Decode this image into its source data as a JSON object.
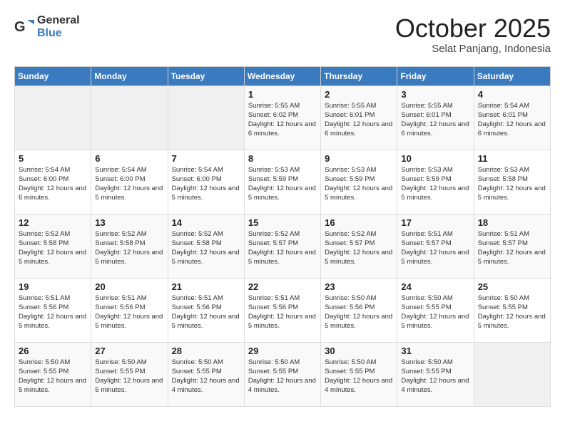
{
  "logo": {
    "general": "General",
    "blue": "Blue"
  },
  "title": "October 2025",
  "location": "Selat Panjang, Indonesia",
  "headers": [
    "Sunday",
    "Monday",
    "Tuesday",
    "Wednesday",
    "Thursday",
    "Friday",
    "Saturday"
  ],
  "weeks": [
    [
      {
        "day": "",
        "info": ""
      },
      {
        "day": "",
        "info": ""
      },
      {
        "day": "",
        "info": ""
      },
      {
        "day": "1",
        "info": "Sunrise: 5:55 AM\nSunset: 6:02 PM\nDaylight: 12 hours and 6 minutes."
      },
      {
        "day": "2",
        "info": "Sunrise: 5:55 AM\nSunset: 6:01 PM\nDaylight: 12 hours and 6 minutes."
      },
      {
        "day": "3",
        "info": "Sunrise: 5:55 AM\nSunset: 6:01 PM\nDaylight: 12 hours and 6 minutes."
      },
      {
        "day": "4",
        "info": "Sunrise: 5:54 AM\nSunset: 6:01 PM\nDaylight: 12 hours and 6 minutes."
      }
    ],
    [
      {
        "day": "5",
        "info": "Sunrise: 5:54 AM\nSunset: 6:00 PM\nDaylight: 12 hours and 6 minutes."
      },
      {
        "day": "6",
        "info": "Sunrise: 5:54 AM\nSunset: 6:00 PM\nDaylight: 12 hours and 5 minutes."
      },
      {
        "day": "7",
        "info": "Sunrise: 5:54 AM\nSunset: 6:00 PM\nDaylight: 12 hours and 5 minutes."
      },
      {
        "day": "8",
        "info": "Sunrise: 5:53 AM\nSunset: 5:59 PM\nDaylight: 12 hours and 5 minutes."
      },
      {
        "day": "9",
        "info": "Sunrise: 5:53 AM\nSunset: 5:59 PM\nDaylight: 12 hours and 5 minutes."
      },
      {
        "day": "10",
        "info": "Sunrise: 5:53 AM\nSunset: 5:59 PM\nDaylight: 12 hours and 5 minutes."
      },
      {
        "day": "11",
        "info": "Sunrise: 5:53 AM\nSunset: 5:58 PM\nDaylight: 12 hours and 5 minutes."
      }
    ],
    [
      {
        "day": "12",
        "info": "Sunrise: 5:52 AM\nSunset: 5:58 PM\nDaylight: 12 hours and 5 minutes."
      },
      {
        "day": "13",
        "info": "Sunrise: 5:52 AM\nSunset: 5:58 PM\nDaylight: 12 hours and 5 minutes."
      },
      {
        "day": "14",
        "info": "Sunrise: 5:52 AM\nSunset: 5:58 PM\nDaylight: 12 hours and 5 minutes."
      },
      {
        "day": "15",
        "info": "Sunrise: 5:52 AM\nSunset: 5:57 PM\nDaylight: 12 hours and 5 minutes."
      },
      {
        "day": "16",
        "info": "Sunrise: 5:52 AM\nSunset: 5:57 PM\nDaylight: 12 hours and 5 minutes."
      },
      {
        "day": "17",
        "info": "Sunrise: 5:51 AM\nSunset: 5:57 PM\nDaylight: 12 hours and 5 minutes."
      },
      {
        "day": "18",
        "info": "Sunrise: 5:51 AM\nSunset: 5:57 PM\nDaylight: 12 hours and 5 minutes."
      }
    ],
    [
      {
        "day": "19",
        "info": "Sunrise: 5:51 AM\nSunset: 5:56 PM\nDaylight: 12 hours and 5 minutes."
      },
      {
        "day": "20",
        "info": "Sunrise: 5:51 AM\nSunset: 5:56 PM\nDaylight: 12 hours and 5 minutes."
      },
      {
        "day": "21",
        "info": "Sunrise: 5:51 AM\nSunset: 5:56 PM\nDaylight: 12 hours and 5 minutes."
      },
      {
        "day": "22",
        "info": "Sunrise: 5:51 AM\nSunset: 5:56 PM\nDaylight: 12 hours and 5 minutes."
      },
      {
        "day": "23",
        "info": "Sunrise: 5:50 AM\nSunset: 5:56 PM\nDaylight: 12 hours and 5 minutes."
      },
      {
        "day": "24",
        "info": "Sunrise: 5:50 AM\nSunset: 5:55 PM\nDaylight: 12 hours and 5 minutes."
      },
      {
        "day": "25",
        "info": "Sunrise: 5:50 AM\nSunset: 5:55 PM\nDaylight: 12 hours and 5 minutes."
      }
    ],
    [
      {
        "day": "26",
        "info": "Sunrise: 5:50 AM\nSunset: 5:55 PM\nDaylight: 12 hours and 5 minutes."
      },
      {
        "day": "27",
        "info": "Sunrise: 5:50 AM\nSunset: 5:55 PM\nDaylight: 12 hours and 5 minutes."
      },
      {
        "day": "28",
        "info": "Sunrise: 5:50 AM\nSunset: 5:55 PM\nDaylight: 12 hours and 4 minutes."
      },
      {
        "day": "29",
        "info": "Sunrise: 5:50 AM\nSunset: 5:55 PM\nDaylight: 12 hours and 4 minutes."
      },
      {
        "day": "30",
        "info": "Sunrise: 5:50 AM\nSunset: 5:55 PM\nDaylight: 12 hours and 4 minutes."
      },
      {
        "day": "31",
        "info": "Sunrise: 5:50 AM\nSunset: 5:55 PM\nDaylight: 12 hours and 4 minutes."
      },
      {
        "day": "",
        "info": ""
      }
    ]
  ]
}
